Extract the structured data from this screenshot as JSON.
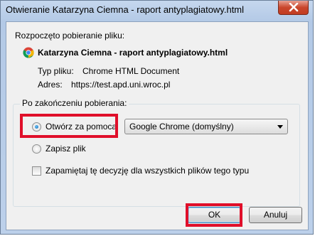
{
  "window": {
    "title": "Otwieranie Katarzyna Ciemna - raport antyplagiatowy.html"
  },
  "dialog": {
    "intro": "Rozpoczęto pobieranie pliku:",
    "file_name": "Katarzyna Ciemna - raport antyplagiatowy.html",
    "file_type_label": "Typ pliku:",
    "file_type_value": "Chrome HTML Document",
    "address_label": "Adres:",
    "address_value": "https://test.apd.uni.wroc.pl",
    "group_label": "Po zakończeniu pobierania:",
    "open_with_label": "Otwórz za pomocą",
    "open_with_selected": true,
    "application_select_value": "Google Chrome (domyślny)",
    "save_file_label": "Zapisz plik",
    "save_file_selected": false,
    "remember_label": "Zapamiętaj tę decyzję dla wszystkich plików tego typu",
    "remember_checked": false,
    "ok_label": "OK",
    "cancel_label": "Anuluj"
  },
  "icons": {
    "close": "close-icon",
    "file": "chrome-icon"
  },
  "colors": {
    "highlight": "#e00f2a",
    "window_frame": "#b3c9e6",
    "client_bg": "#f0f0f0"
  }
}
